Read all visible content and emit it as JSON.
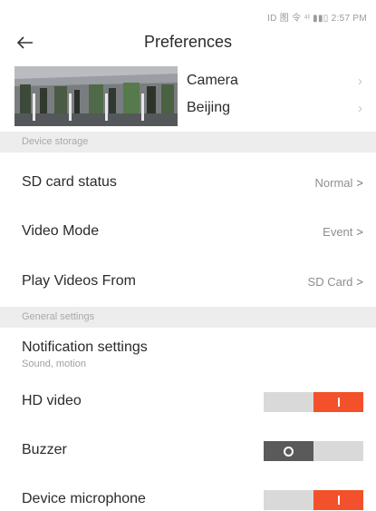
{
  "status_bar": {
    "text": "ID 图 令 ⁴ᴵ ▮▮▯ 2:57 PM"
  },
  "header": {
    "title": "Preferences"
  },
  "device": {
    "name_label": "Camera",
    "location_label": "Beijing"
  },
  "sections": {
    "storage": "Device storage",
    "general": "General settings"
  },
  "storage_rows": [
    {
      "label": "SD card status",
      "value": "Normal"
    },
    {
      "label": "Video Mode",
      "value": "Event"
    },
    {
      "label": "Play Videos From",
      "value": "SD Card"
    }
  ],
  "notification": {
    "label": "Notification settings",
    "sub": "Sound, motion"
  },
  "toggles": [
    {
      "label": "HD video",
      "on": true
    },
    {
      "label": "Buzzer",
      "on": false
    },
    {
      "label": "Device microphone",
      "on": true
    }
  ],
  "colors": {
    "accent_on": "#f2512b",
    "off_knob": "#5a5a5a",
    "track": "#d9d9d9",
    "section_bg": "#ededed"
  },
  "icons": {
    "back": "arrow-left-icon",
    "chevron": "chevron-right-icon",
    "arrow": "arrow-right-icon"
  }
}
